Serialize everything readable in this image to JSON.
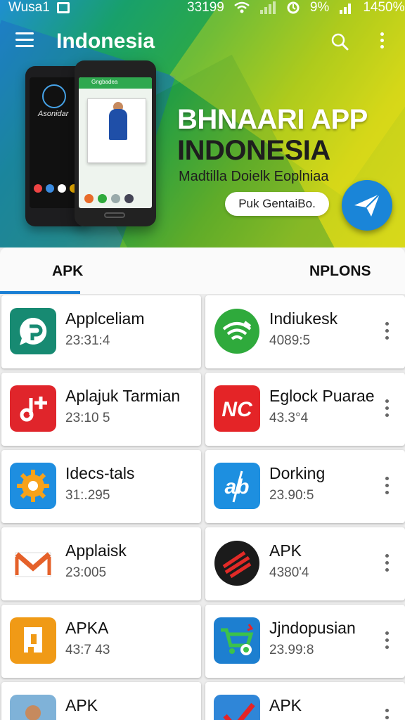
{
  "status_bar": {
    "carrier": "Wusa1",
    "time": "33199",
    "battery_text": "9%",
    "extra": "1450%"
  },
  "app_bar": {
    "title": "Indonesia"
  },
  "banner": {
    "phone_brand": "Asonidar",
    "phone_header": "Gngbadea",
    "title_line1": "BHNAARI APP",
    "title_line2": "INDONESIA",
    "subtitle": "Madtilla Doielk Eoplniaa",
    "button_label": "Puk GentaiBo."
  },
  "tabs": [
    {
      "label": "APK",
      "active": true
    },
    {
      "label": "NPLONS",
      "active": false
    }
  ],
  "apps": [
    {
      "name": "Applceliam",
      "meta": "23:31:4",
      "icon": "chat-bubble-icon",
      "color": "#178a72",
      "menu": false
    },
    {
      "name": "Indiukesk",
      "meta": "4089:5",
      "icon": "wifi-signal-icon",
      "color": "#2faa3c",
      "menu": true
    },
    {
      "name": "Aplajuk Tarmian",
      "meta": "23:10 5",
      "icon": "music-plus-icon",
      "color": "#e0252b",
      "menu": false
    },
    {
      "name": "Eglock Puarae",
      "meta": "43.3°4",
      "icon": "nc-letters-icon",
      "color": "#e42427",
      "menu": true
    },
    {
      "name": "Idecs-tals",
      "meta": "31:.295",
      "icon": "gear-icon",
      "color": "#1e8ee0",
      "menu": false
    },
    {
      "name": "Dorking",
      "meta": "23.90:5",
      "icon": "ab-letters-icon",
      "color": "#1d8fe0",
      "menu": true
    },
    {
      "name": "Applaisk",
      "meta": "23:005",
      "icon": "mail-envelope-icon",
      "color": "#e5612a",
      "menu": false
    },
    {
      "name": "APK",
      "meta": "4380'4",
      "icon": "striped-globe-icon",
      "color": "#1b1b1b",
      "menu": true
    },
    {
      "name": "APKA",
      "meta": "43:7 43",
      "icon": "puzzle-document-icon",
      "color": "#f09a16",
      "menu": false
    },
    {
      "name": "Jjndopusian",
      "meta": "23.99:8",
      "icon": "shopping-cart-icon",
      "color": "#1d7fd0",
      "menu": true
    },
    {
      "name": "APK",
      "meta": "",
      "icon": "person-photo-icon",
      "color": "#7fb2d8",
      "menu": false
    },
    {
      "name": "APK",
      "meta": "",
      "icon": "check-mark-icon",
      "color": "#2f86d8",
      "menu": true
    }
  ]
}
